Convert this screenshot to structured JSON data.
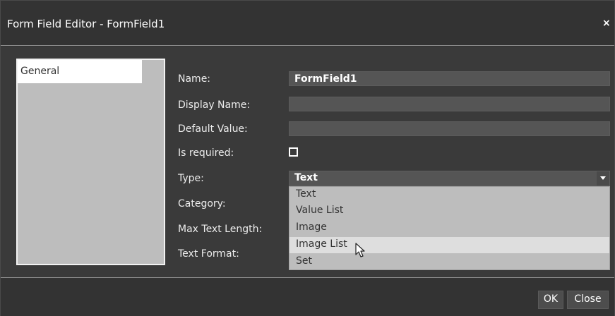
{
  "dialog": {
    "title": "Form Field Editor - FormField1",
    "close_label": "×"
  },
  "nav": {
    "items": [
      {
        "label": "General"
      }
    ]
  },
  "form": {
    "name_label": "Name:",
    "name_value": "FormField1",
    "display_name_label": "Display Name:",
    "display_name_value": "",
    "default_value_label": "Default Value:",
    "default_value_value": "",
    "is_required_label": "Is required:",
    "is_required_checked": false,
    "type_label": "Type:",
    "type_selected": "Text",
    "category_label": "Category:",
    "max_text_length_label": "Max Text Length:",
    "text_format_label": "Text Format:"
  },
  "type_dropdown": {
    "options": [
      "Text",
      "Value List",
      "Image",
      "Image List",
      "Set"
    ],
    "hovered": "Image List"
  },
  "footer": {
    "ok_label": "OK",
    "close_label": "Close"
  },
  "colors": {
    "dialog_bg": "#333333",
    "body_bg": "#3a3a3a",
    "field_bg": "#555555",
    "dropdown_bg": "#bdbdbd",
    "option_hover_bg": "#dedede"
  }
}
